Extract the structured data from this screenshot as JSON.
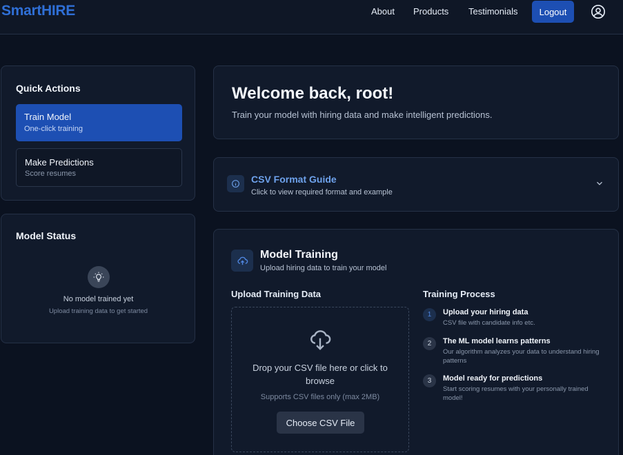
{
  "brand": {
    "part1": "Smart",
    "part2": "HIRE"
  },
  "nav": {
    "about": "About",
    "products": "Products",
    "testimonials": "Testimonials",
    "logout": "Logout"
  },
  "quick_actions": {
    "title": "Quick Actions",
    "train": {
      "title": "Train Model",
      "subtitle": "One-click training"
    },
    "predict": {
      "title": "Make Predictions",
      "subtitle": "Score resumes"
    }
  },
  "model_status": {
    "title": "Model Status",
    "empty_title": "No model trained yet",
    "empty_sub": "Upload training data to get started"
  },
  "welcome": {
    "title": "Welcome back, root!",
    "subtitle": "Train your model with hiring data and make intelligent predictions."
  },
  "csv_guide": {
    "title": "CSV Format Guide",
    "subtitle": "Click to view required format and example"
  },
  "training": {
    "title": "Model Training",
    "subtitle": "Upload hiring data to train your model",
    "upload_label": "Upload Training Data",
    "drop_text": "Drop your CSV file here or click to browse",
    "drop_hint": "Supports CSV files only (max 2MB)",
    "choose_button": "Choose CSV File",
    "process_label": "Training Process",
    "steps": [
      {
        "num": "1",
        "title": "Upload your hiring data",
        "desc": "CSV file with candidate info etc."
      },
      {
        "num": "2",
        "title": "The ML model learns patterns",
        "desc": "Our algorithm analyzes your data to understand hiring patterns"
      },
      {
        "num": "3",
        "title": "Model ready for predictions",
        "desc": "Start scoring resumes with your personally trained model!"
      }
    ]
  },
  "colors": {
    "accent": "#1d4fb3",
    "link": "#6ea2ec",
    "background": "#0b1220",
    "card": "#111a2b"
  }
}
